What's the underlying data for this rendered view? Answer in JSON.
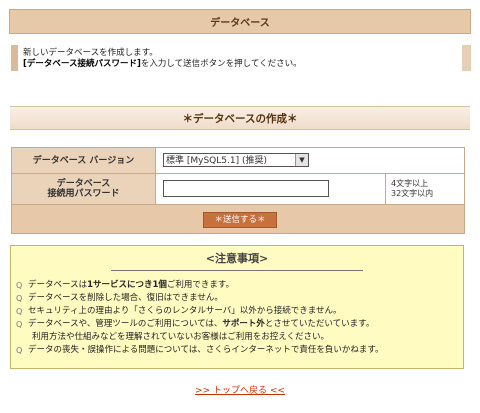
{
  "header": {
    "title": "データベース"
  },
  "info": {
    "line1": "新しいデータベースを作成します。",
    "line2_bold": "[データベース接続パスワード]",
    "line2_rest": "を入力して送信ボタンを押してください。"
  },
  "section": {
    "title": "＊データベースの作成＊"
  },
  "form": {
    "version_label": "データベース バージョン",
    "version_value": "標準 [MySQL5.1] (推奨)",
    "password_label_1": "データベース",
    "password_label_2": "接続用パスワード",
    "password_value": "",
    "hint_1": "4文字以上",
    "hint_2": "32文字以内",
    "submit_label": "＊送信する＊"
  },
  "notice": {
    "title": "<注意事項>",
    "items": [
      {
        "pre": "データベースは",
        "bold": "1サービスにつき1個",
        "post": "ご利用できます。"
      },
      {
        "pre": "データベースを削除した場合、復旧はできません。",
        "bold": "",
        "post": ""
      },
      {
        "pre": "セキュリティ上の理由より「さくらのレンタルサーバ」以外から接続できません。",
        "bold": "",
        "post": ""
      },
      {
        "pre": "データベースや、管理ツールのご利用については、",
        "bold": "サポート外",
        "post": "とさせていただいています。"
      },
      {
        "pre": "利用方法や仕組みなどを理解されていないお客様はご利用をお控えください。",
        "bold": "",
        "post": ""
      },
      {
        "pre": "データの喪失・誤操作による問題については、さくらインターネットで責任を負いかねます。",
        "bold": "",
        "post": ""
      }
    ]
  },
  "footer": {
    "top_link": ">> トップへ戻る <<"
  }
}
